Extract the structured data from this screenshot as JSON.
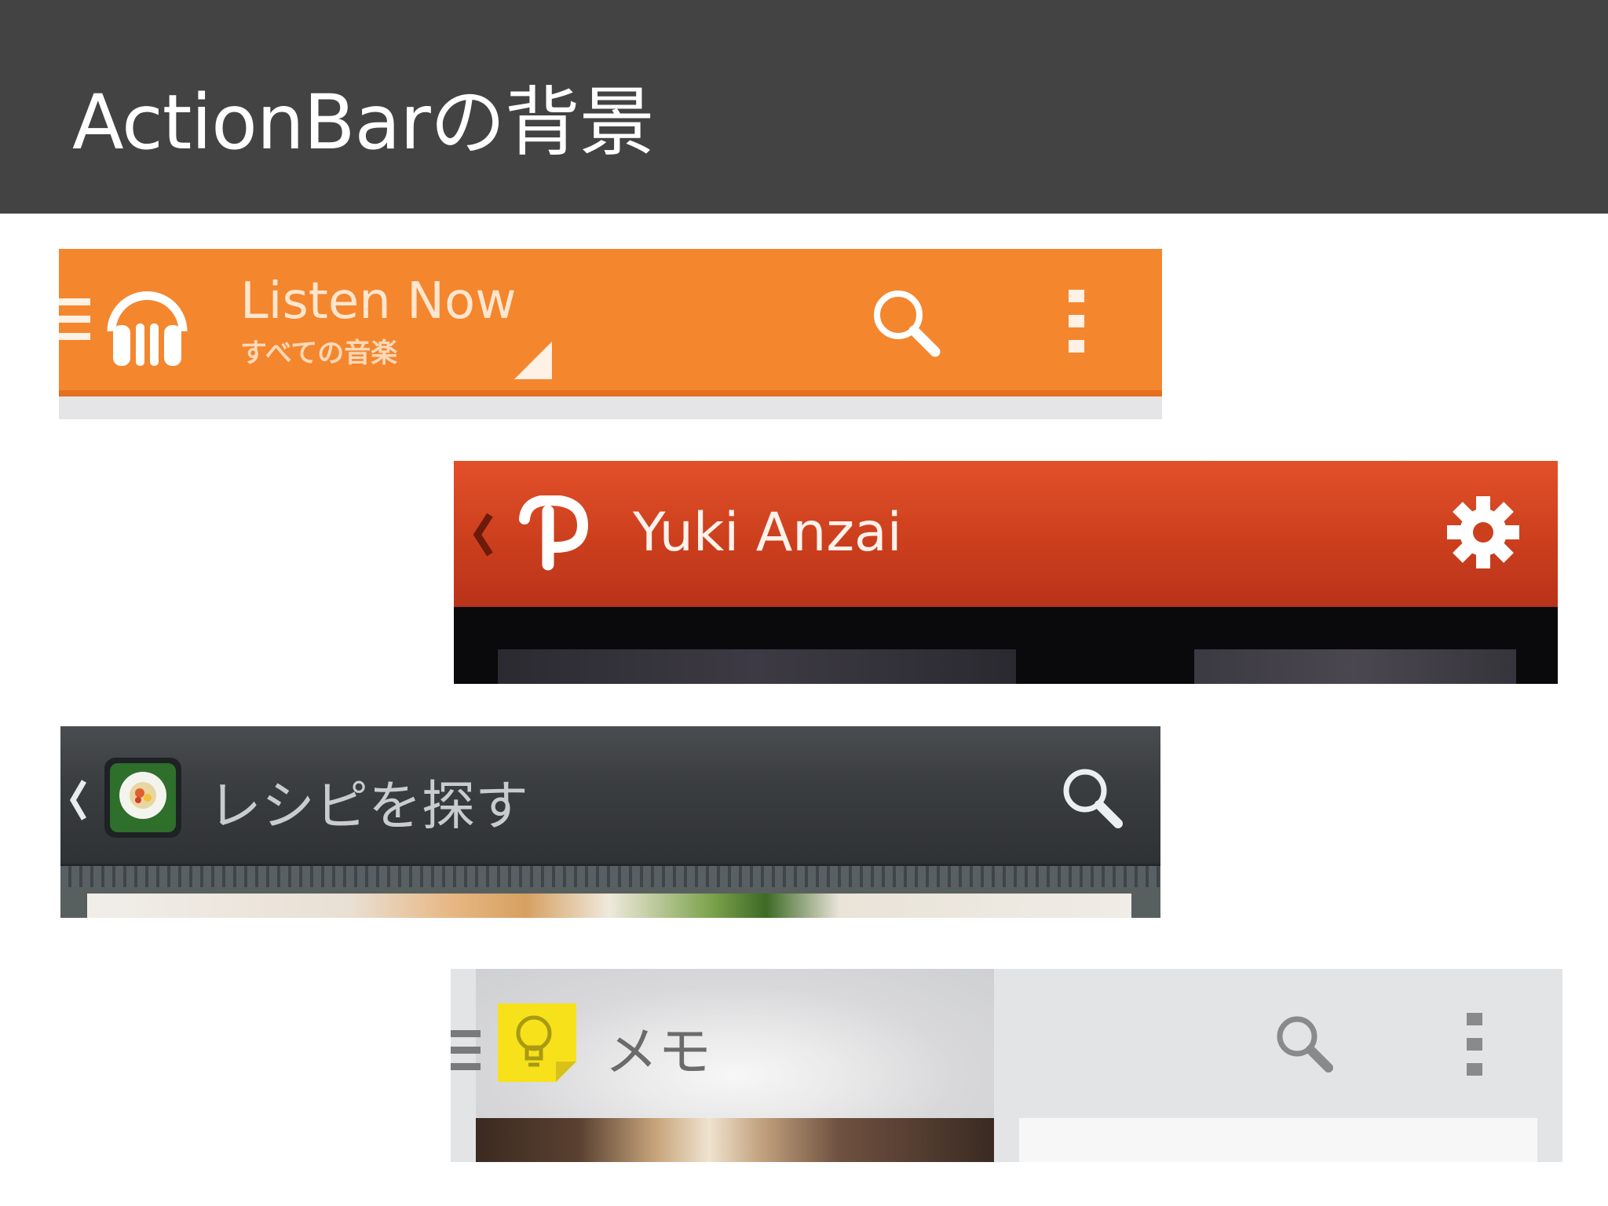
{
  "slide": {
    "title": "ActionBarの背景"
  },
  "bars": [
    {
      "app": "Google Play Music",
      "title": "Listen Now",
      "subtitle": "すべての音楽",
      "icons": [
        "menu-icon",
        "headphones-icon",
        "dropdown-corner-icon",
        "search-icon",
        "overflow-menu-icon"
      ],
      "colors": {
        "background": "#f4862e",
        "text": "#ffe6cf"
      }
    },
    {
      "app": "Path",
      "title": "Yuki Anzai",
      "icons": [
        "back-chevron-icon",
        "path-logo-icon",
        "settings-gear-icon"
      ],
      "colors": {
        "background": "#cc3f1d",
        "text": "#fff2ec"
      }
    },
    {
      "app": "Recipe",
      "title": "レシピを探す",
      "icons": [
        "back-chevron-icon",
        "sushi-app-icon",
        "search-icon"
      ],
      "colors": {
        "background": "#3b3e41",
        "text": "#c9cccd"
      }
    },
    {
      "app": "Google Keep",
      "title": "メモ",
      "icons": [
        "menu-icon",
        "keep-bulb-icon",
        "search-icon",
        "overflow-menu-icon"
      ],
      "colors": {
        "background": "#e3e4e6",
        "text": "#6b6b6b"
      }
    }
  ]
}
